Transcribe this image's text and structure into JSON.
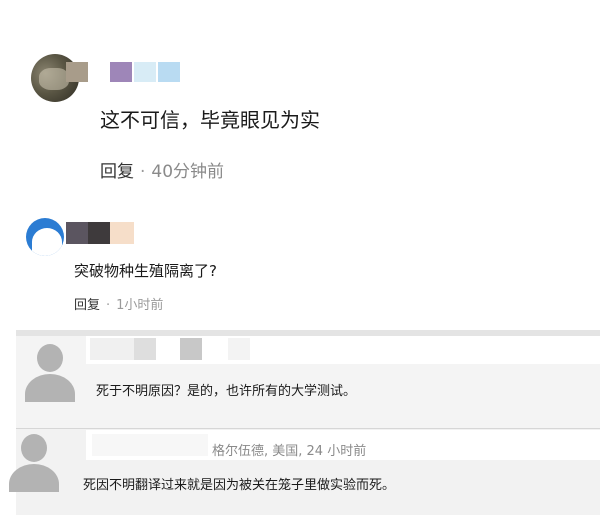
{
  "comments": [
    {
      "text": "这不可信，毕竟眼见为实",
      "reply_label": "回复",
      "separator": "·",
      "time": "40分钟前",
      "author_redacted": true
    },
    {
      "text": "突破物种生殖隔离了?",
      "reply_label": "回复",
      "separator": "·",
      "time": "1小时前",
      "author_redacted": true
    },
    {
      "text": "死于不明原因？是的，也许所有的大学测试。",
      "author_redacted": true
    },
    {
      "author_visible": "格尔伍德, 美国, 24 小时前",
      "text": "死因不明翻译过来就是因为被关在笼子里做实验而死。"
    }
  ],
  "colors": {
    "text": "#1a1a1a",
    "muted": "#8a8a8a",
    "panel_bg": "#f2f2f2",
    "avatar_blue": "#2b7cd3",
    "avatar_gray": "#b3b3b3"
  },
  "icons": {
    "default_avatar": "person-silhouette-icon"
  }
}
